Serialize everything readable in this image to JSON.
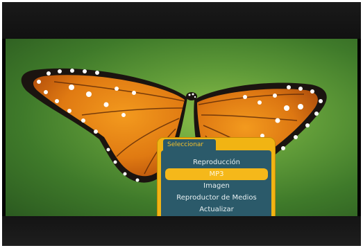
{
  "menu": {
    "title": "Seleccionar",
    "items": [
      {
        "label": "Reproducción",
        "selected": false
      },
      {
        "label": "MP3",
        "selected": true
      },
      {
        "label": "Imagen",
        "selected": false
      },
      {
        "label": "Reproductor de Medios",
        "selected": false
      },
      {
        "label": "Actualizar",
        "selected": false
      }
    ]
  },
  "colors": {
    "panel_accent": "#f1b413",
    "panel_body": "#2b5a6a",
    "highlight": "#f5b81a"
  },
  "background": {
    "subject": "monarch-butterfly-image"
  }
}
